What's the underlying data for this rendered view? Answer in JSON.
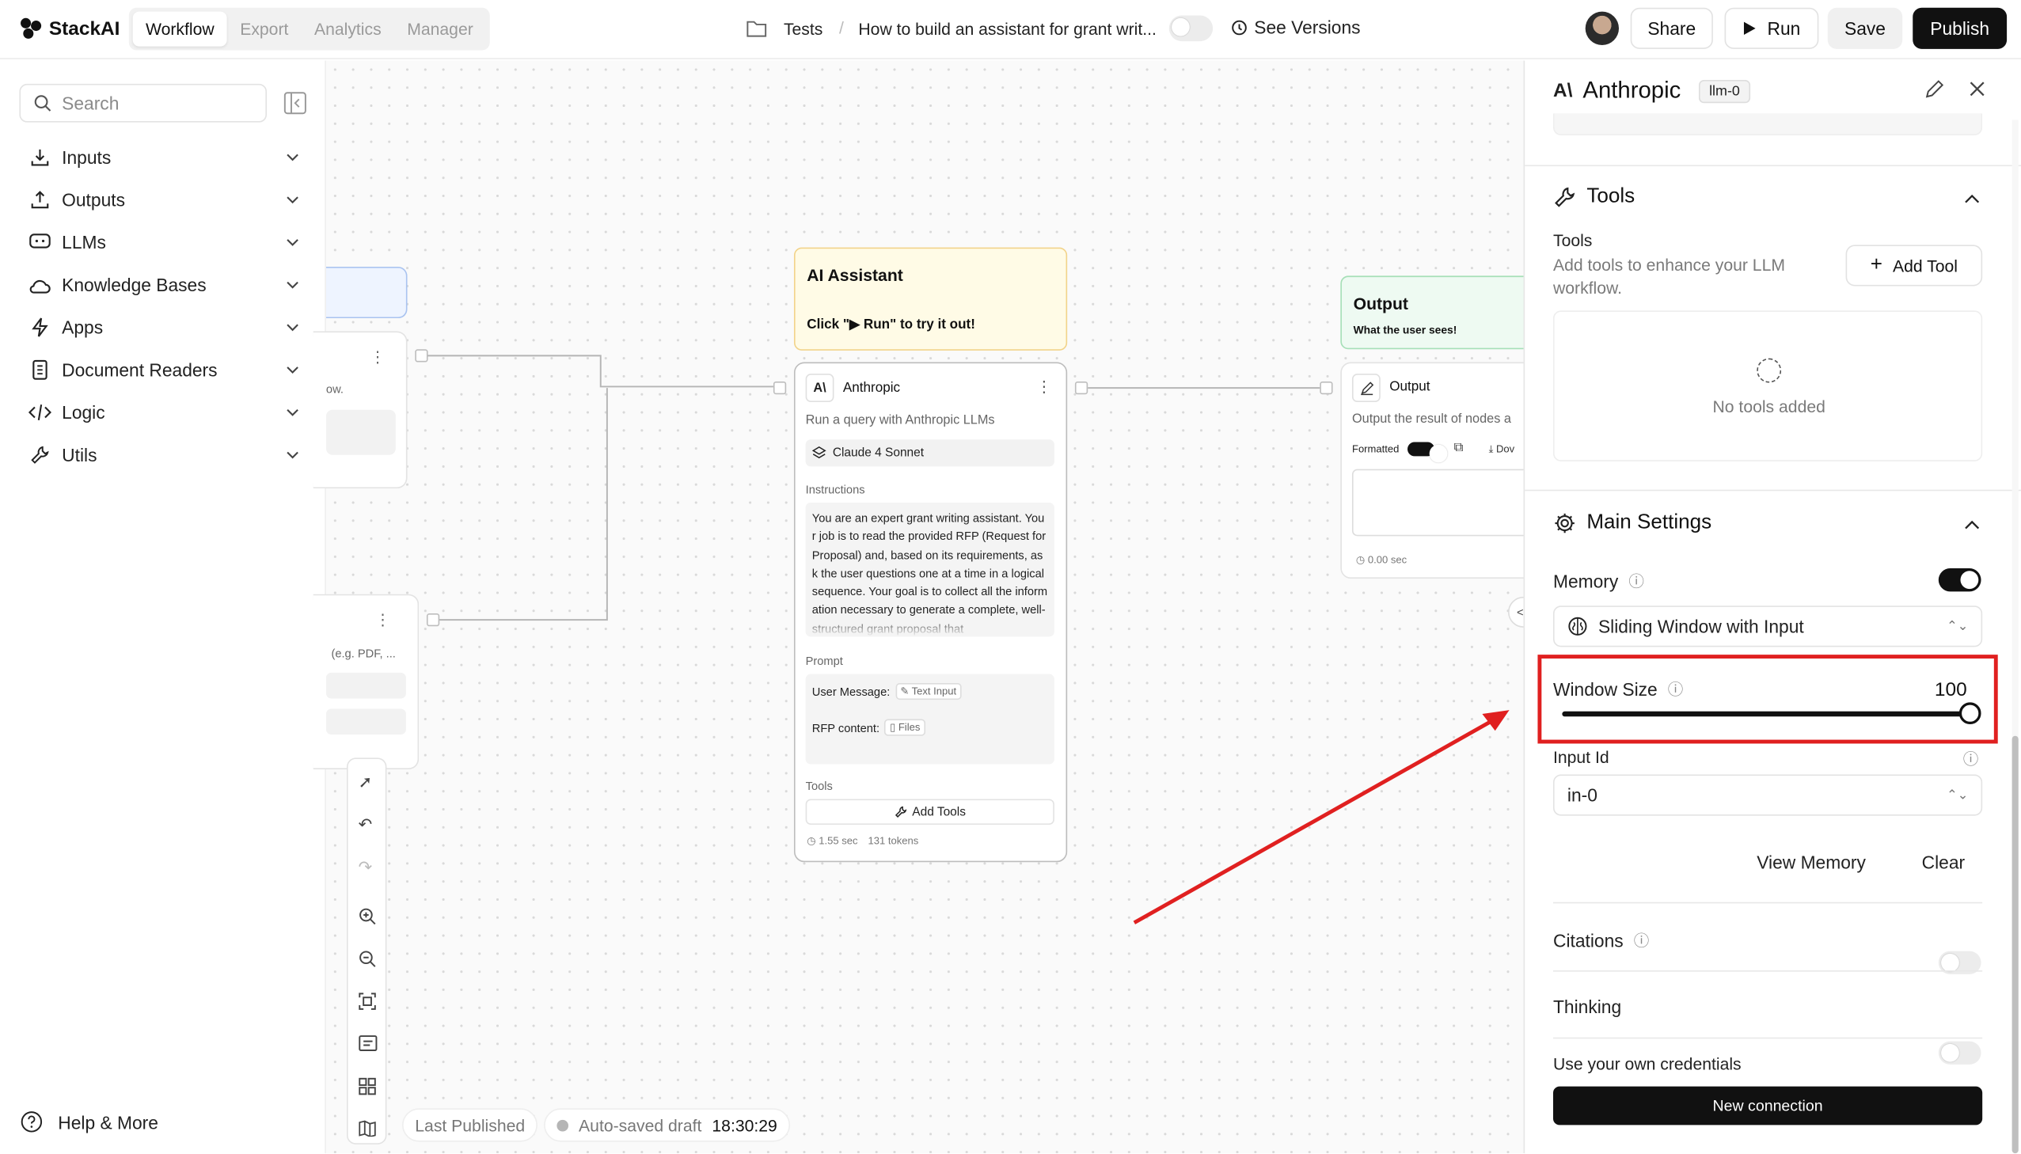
{
  "app": {
    "name": "StackAI"
  },
  "tabs": [
    "Workflow",
    "Export",
    "Analytics",
    "Manager"
  ],
  "breadcrumb": {
    "folder": "Tests",
    "separator": "/",
    "project": "How to build an assistant for grant writ..."
  },
  "header": {
    "see_versions": "See Versions",
    "share": "Share",
    "run": "Run",
    "save": "Save",
    "publish": "Publish"
  },
  "sidebar": {
    "search_placeholder": "Search",
    "items": [
      {
        "label": "Inputs",
        "icon": "download-icon"
      },
      {
        "label": "Outputs",
        "icon": "upload-icon"
      },
      {
        "label": "LLMs",
        "icon": "chat-icon"
      },
      {
        "label": "Knowledge Bases",
        "icon": "cloud-icon"
      },
      {
        "label": "Apps",
        "icon": "bolt-icon"
      },
      {
        "label": "Document Readers",
        "icon": "document-icon"
      },
      {
        "label": "Logic",
        "icon": "code-icon"
      },
      {
        "label": "Utils",
        "icon": "wrench-icon"
      }
    ],
    "help": "Help & More"
  },
  "canvas": {
    "partial_left_text_1": "ow.",
    "partial_left_text_2": "(e.g. PDF, ...",
    "note": {
      "title": "AI Assistant",
      "body": "Click \"▶ Run\" to try it out!"
    },
    "llm_node": {
      "title": "Anthropic",
      "description": "Run a query with Anthropic LLMs",
      "model": "Claude 4 Sonnet",
      "instructions_label": "Instructions",
      "instructions_text": "You are an expert grant writing assistant. Your job is to read the provided RFP (Request for Proposal) and, based on its requirements, ask the user questions one at a time in a logical sequence. Your goal is to collect all the information necessary to generate a complete, well-structured grant proposal that",
      "prompt_label": "Prompt",
      "prompt_line1_label": "User Message:",
      "prompt_line1_chip": "Text Input",
      "prompt_line2_label": "RFP content:",
      "prompt_line2_chip": "Files",
      "tools_label": "Tools",
      "add_tools": "Add Tools",
      "time": "1.55 sec",
      "tokens": "131 tokens"
    },
    "output_header": {
      "title": "Output",
      "subtitle": "What the user sees!"
    },
    "output_node": {
      "title": "Output",
      "description": "Output the result of nodes a",
      "formatted_label": "Formatted",
      "download": "Dov",
      "time": "0.00 sec"
    },
    "status": {
      "last_published": "Last Published",
      "autosaved": "Auto-saved draft",
      "time": "18:30:29"
    }
  },
  "panel": {
    "title": "Anthropic",
    "node_id": "llm-0",
    "tools_section": {
      "heading": "Tools",
      "label": "Tools",
      "description": "Add tools to enhance your LLM workflow.",
      "add_button": "Add Tool",
      "empty": "No tools added"
    },
    "main_settings": {
      "heading": "Main Settings",
      "memory_label": "Memory",
      "memory_on": true,
      "memory_type": "Sliding Window with Input",
      "window_size_label": "Window Size",
      "window_size_value": "100",
      "window_size_fraction": 1.0,
      "input_id_label": "Input Id",
      "input_id_value": "in-0",
      "view_memory": "View Memory",
      "clear": "Clear",
      "citations_label": "Citations",
      "citations_on": false,
      "thinking_label": "Thinking",
      "thinking_on": false,
      "credentials_label": "Use your own credentials",
      "new_connection": "New connection"
    }
  },
  "colors": {
    "highlight": "#e02020",
    "dark": "#111111",
    "note_bg": "#fffbe6",
    "output_bg": "#eefaf2",
    "input_bg": "#eef4ff"
  }
}
